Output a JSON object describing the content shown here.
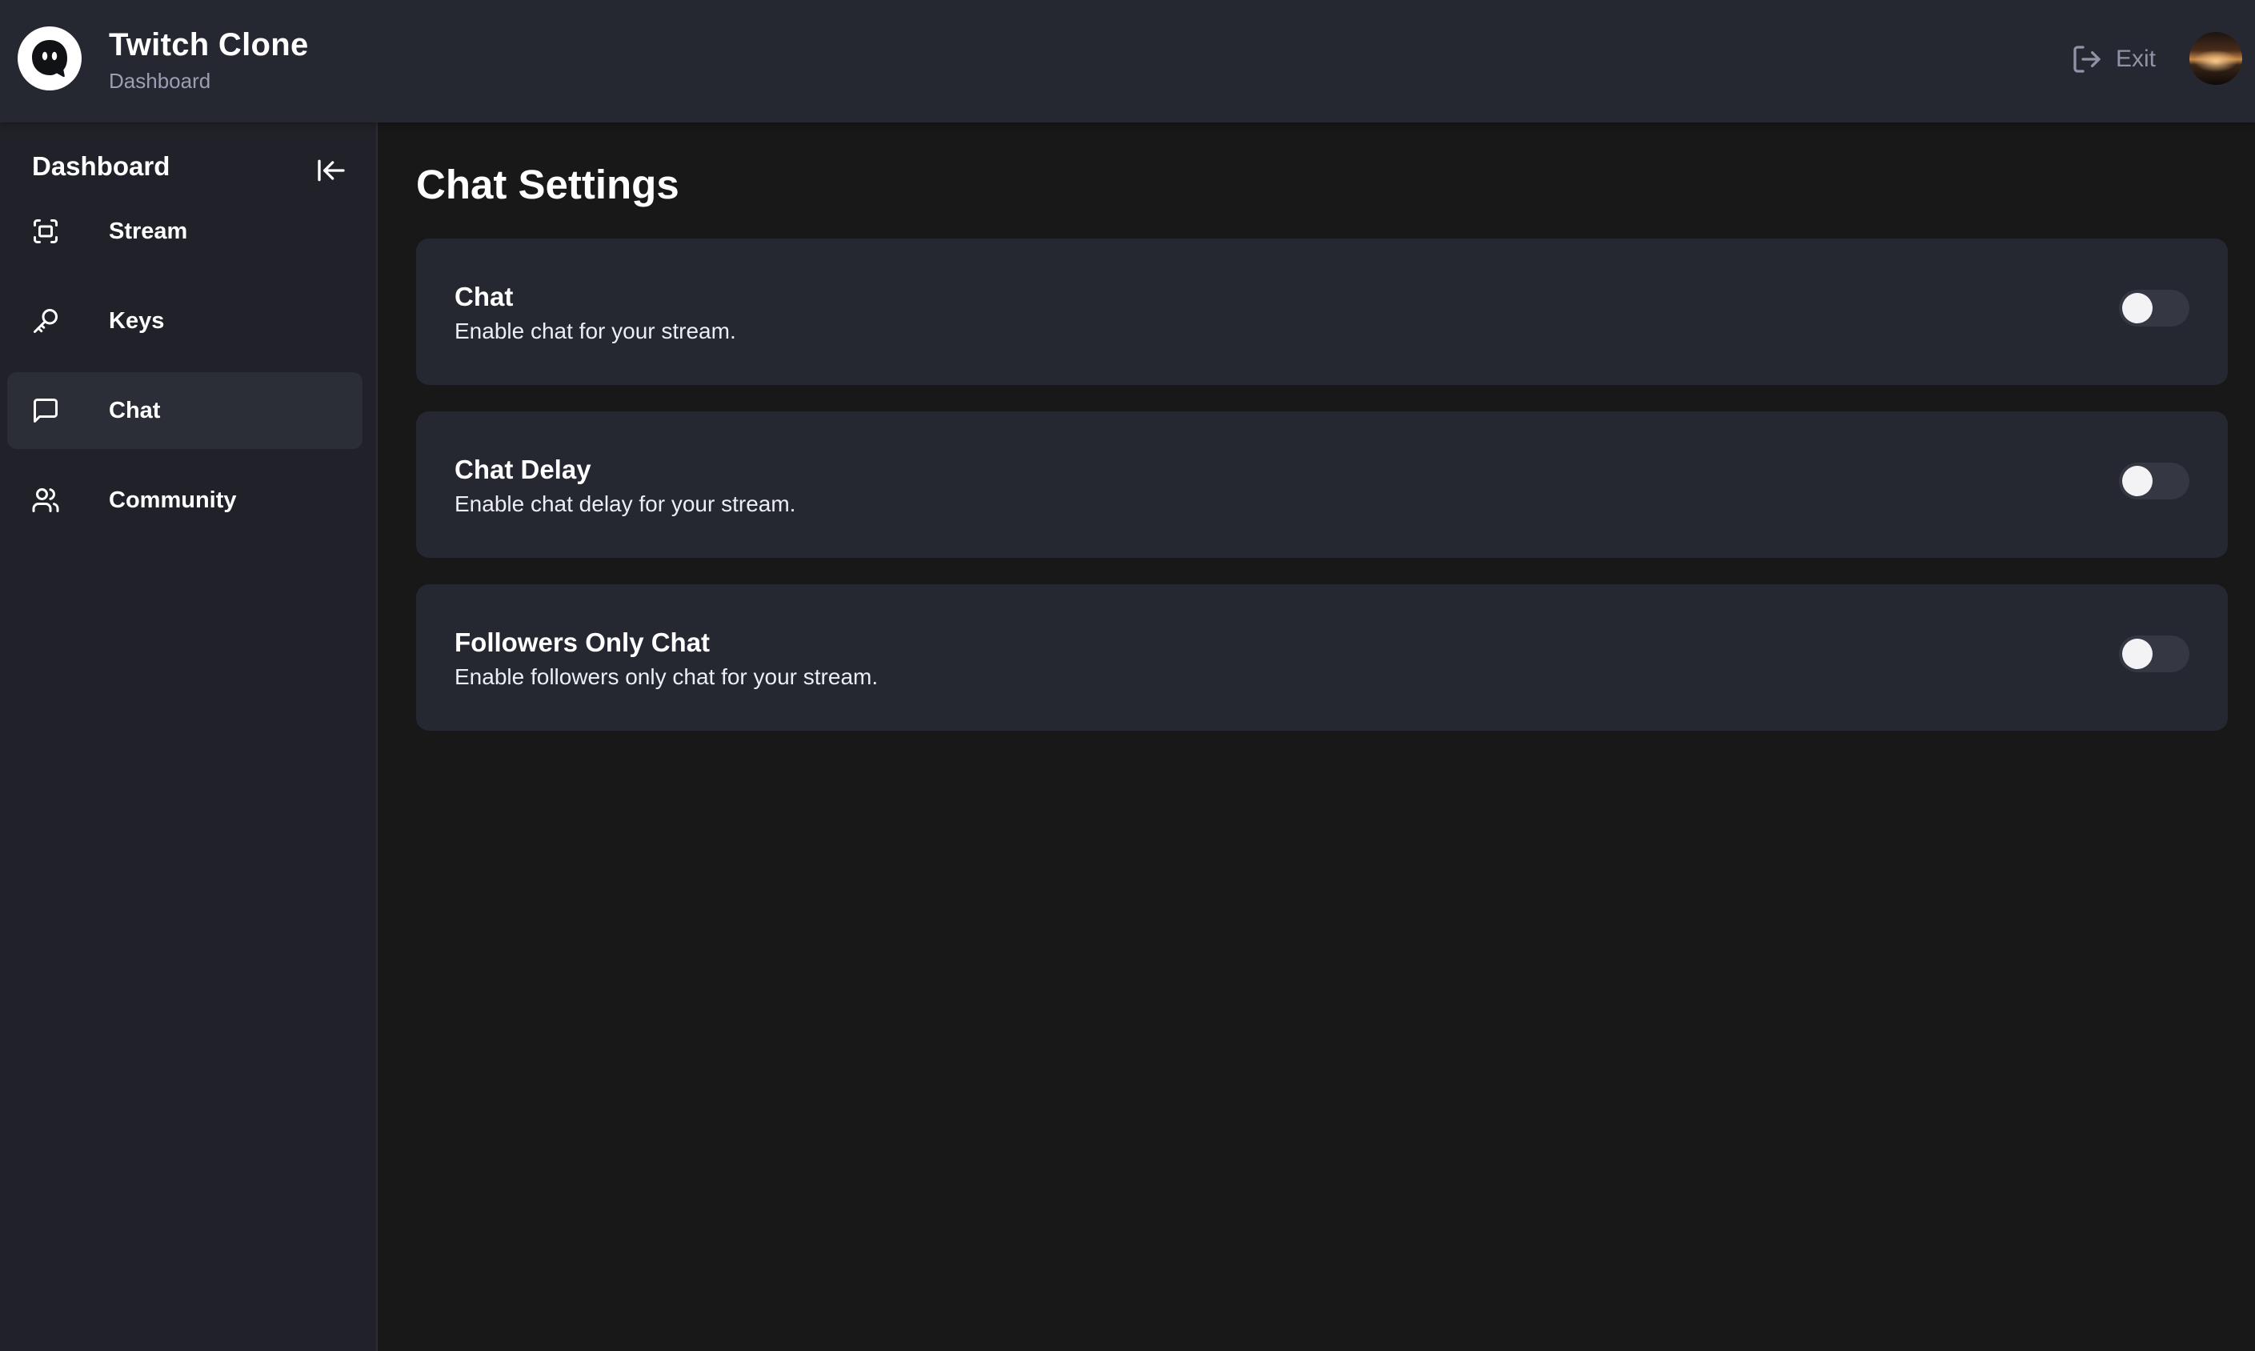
{
  "header": {
    "logo_icon": "ghost-logo-icon",
    "title": "Twitch Clone",
    "subtitle": "Dashboard",
    "exit_label": "Exit",
    "exit_icon": "log-out-icon",
    "avatar": "user-avatar"
  },
  "sidebar": {
    "title": "Dashboard",
    "collapse_icon": "arrow-left-to-line-icon",
    "active_item": "Chat",
    "items": [
      {
        "label": "Stream",
        "icon": "fullscreen-icon"
      },
      {
        "label": "Keys",
        "icon": "key-icon"
      },
      {
        "label": "Chat",
        "icon": "message-square-icon"
      },
      {
        "label": "Community",
        "icon": "users-icon"
      }
    ]
  },
  "main": {
    "title": "Chat Settings",
    "settings": [
      {
        "title": "Chat",
        "description": "Enable chat for your stream.",
        "enabled": false
      },
      {
        "title": "Chat Delay",
        "description": "Enable chat delay for your stream.",
        "enabled": false
      },
      {
        "title": "Followers Only Chat",
        "description": "Enable followers only chat for your stream.",
        "enabled": false
      }
    ]
  },
  "colors": {
    "background": "#181819",
    "surface": "#252731",
    "sidebar": "#212229",
    "active_item": "#2b2d37",
    "muted_text": "#8e93a6",
    "toggle_off": "#353743"
  }
}
